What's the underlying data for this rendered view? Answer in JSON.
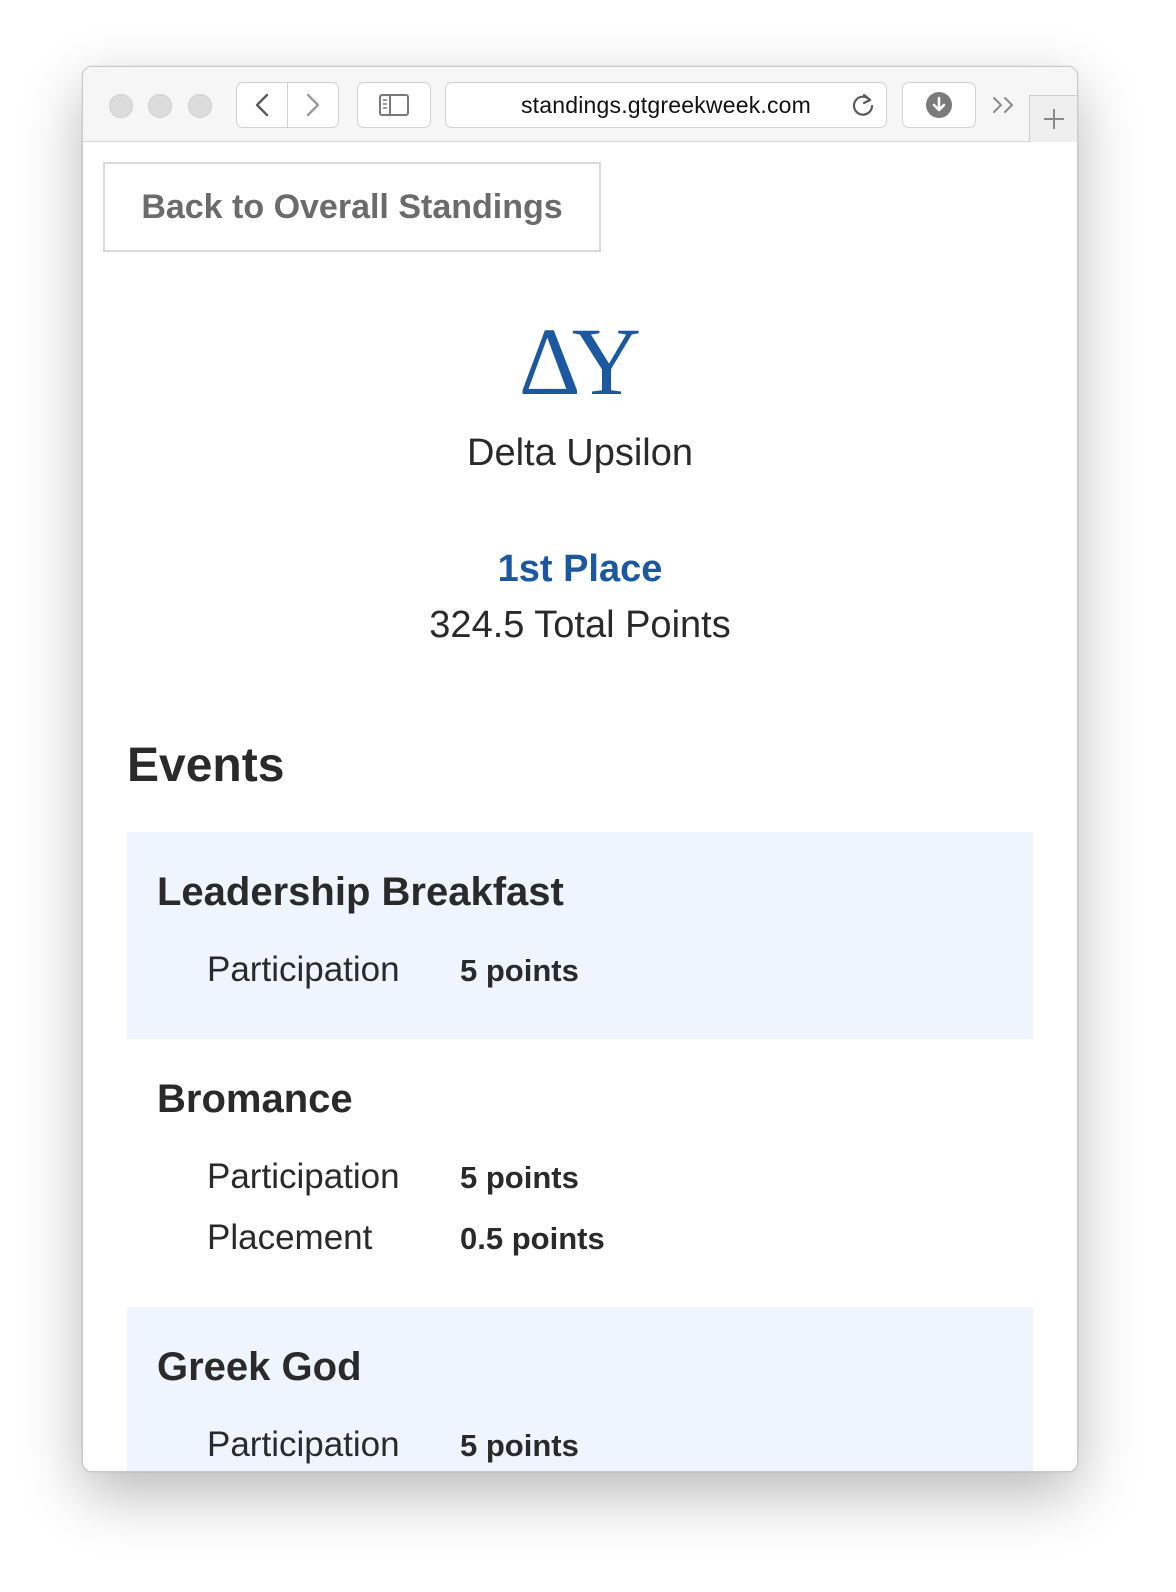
{
  "browser": {
    "url": "standings.gtgreekweek.com"
  },
  "page": {
    "back_button": "Back to Overall Standings",
    "letters": "ΔΥ",
    "org_name": "Delta Upsilon",
    "place": "1st Place",
    "total_points": "324.5 Total Points",
    "events_heading": "Events",
    "events": [
      {
        "name": "Leadership Breakfast",
        "scores": [
          {
            "label": "Participation",
            "points": "5 points"
          }
        ]
      },
      {
        "name": "Bromance",
        "scores": [
          {
            "label": "Participation",
            "points": "5 points"
          },
          {
            "label": "Placement",
            "points": "0.5 points"
          }
        ]
      },
      {
        "name": "Greek God",
        "scores": [
          {
            "label": "Participation",
            "points": "5 points"
          }
        ]
      }
    ]
  },
  "colors": {
    "accent": "#1c58a0",
    "event_shade": "#eef5ff"
  },
  "icons": [
    "back-chevron-icon",
    "forward-chevron-icon",
    "sidebar-icon",
    "reload-icon",
    "download-icon",
    "overflow-chevron-icon",
    "plus-icon"
  ]
}
